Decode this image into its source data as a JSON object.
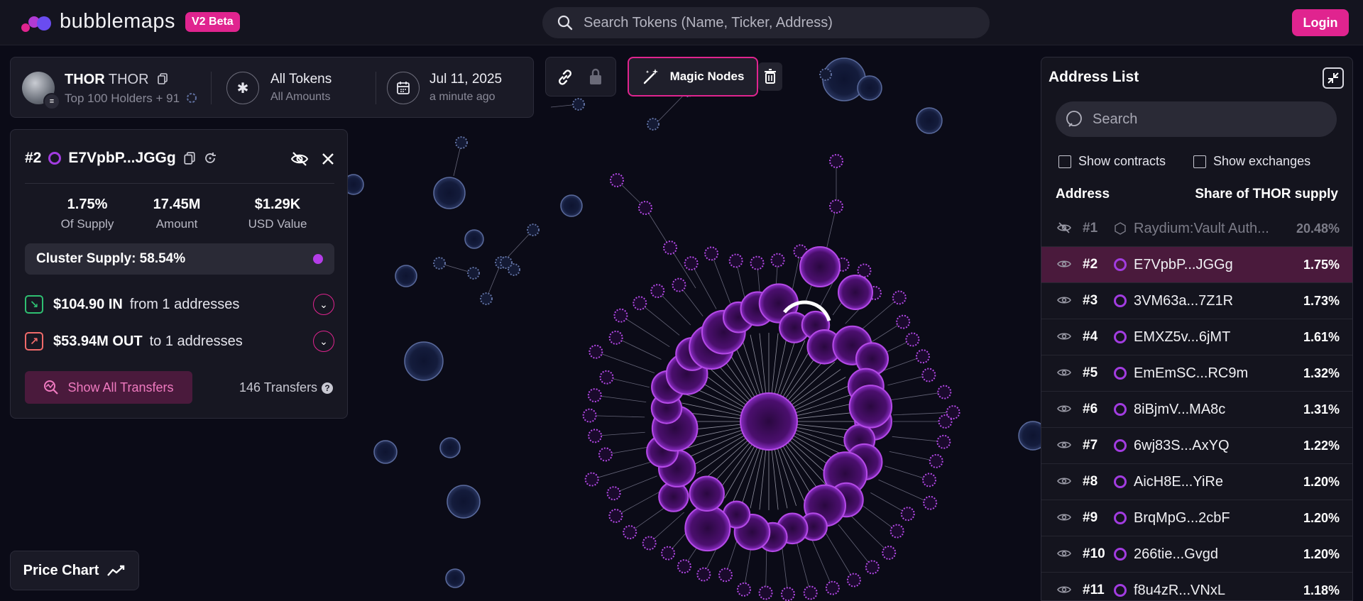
{
  "header": {
    "logo_text": "bubblemaps",
    "beta_badge": "V2 Beta",
    "search_placeholder": "Search Tokens (Name, Ticker, Address)",
    "login_label": "Login"
  },
  "token_panel": {
    "name_bold": "THOR",
    "name_ticker": "THOR",
    "holders_label": "Top 100 Holders + 91",
    "filter_title": "All Tokens",
    "filter_sub": "All Amounts",
    "date_title": "Jul 11, 2025",
    "date_sub": "a minute ago"
  },
  "toolbar": {
    "magic_nodes_label": "Magic Nodes"
  },
  "wallet_panel": {
    "rank": "#2",
    "address": "E7VpbP...JGGg",
    "stats": [
      {
        "value": "1.75%",
        "label": "Of Supply"
      },
      {
        "value": "17.45M",
        "label": "Amount"
      },
      {
        "value": "$1.29K",
        "label": "USD Value"
      }
    ],
    "cluster_supply": "Cluster Supply: 58.54%",
    "inflow": {
      "amount": "$104.90 IN",
      "desc": "from 1 addresses"
    },
    "outflow": {
      "amount": "$53.94M OUT",
      "desc": "to 1 addresses"
    },
    "show_transfers_label": "Show All Transfers",
    "transfers_count": "146 Transfers",
    "help_glyph": "?"
  },
  "price_chart_label": "Price Chart",
  "address_list": {
    "title": "Address List",
    "search_placeholder": "Search",
    "show_contracts_label": "Show contracts",
    "show_exchanges_label": "Show exchanges",
    "col_address": "Address",
    "col_share": "Share of THOR supply",
    "rows": [
      {
        "rank": "#1",
        "address": "Raydium:Vault Auth...",
        "share": "20.48%"
      },
      {
        "rank": "#2",
        "address": "E7VpbP...JGGg",
        "share": "1.75%"
      },
      {
        "rank": "#3",
        "address": "3VM63a...7Z1R",
        "share": "1.73%"
      },
      {
        "rank": "#4",
        "address": "EMXZ5v...6jMT",
        "share": "1.61%"
      },
      {
        "rank": "#5",
        "address": "EmEmSC...RC9m",
        "share": "1.32%"
      },
      {
        "rank": "#6",
        "address": "8iBjmV...MA8c",
        "share": "1.31%"
      },
      {
        "rank": "#7",
        "address": "6wj83S...AxYQ",
        "share": "1.22%"
      },
      {
        "rank": "#8",
        "address": "AicH8E...YiRe",
        "share": "1.20%"
      },
      {
        "rank": "#9",
        "address": "BrqMpG...2cbF",
        "share": "1.20%"
      },
      {
        "rank": "#10",
        "address": "266tie...Gvgd",
        "share": "1.20%"
      },
      {
        "rank": "#11",
        "address": "f8u4zR...VNxL",
        "share": "1.18%"
      }
    ]
  },
  "colors": {
    "accent": "#e0248f",
    "bubble_purple": "#a23ce0",
    "background": "#0b0b17"
  },
  "icons": [
    "search-icon",
    "copy-icon",
    "asterisk-icon",
    "calendar-icon",
    "link-icon",
    "lock-icon",
    "magic-wand-icon",
    "trash-icon",
    "eye-off-icon",
    "close-icon",
    "refresh-icon",
    "inflow-icon",
    "outflow-icon",
    "chevron-down-icon",
    "transfers-icon",
    "trend-icon",
    "collapse-icon",
    "eye-icon"
  ]
}
